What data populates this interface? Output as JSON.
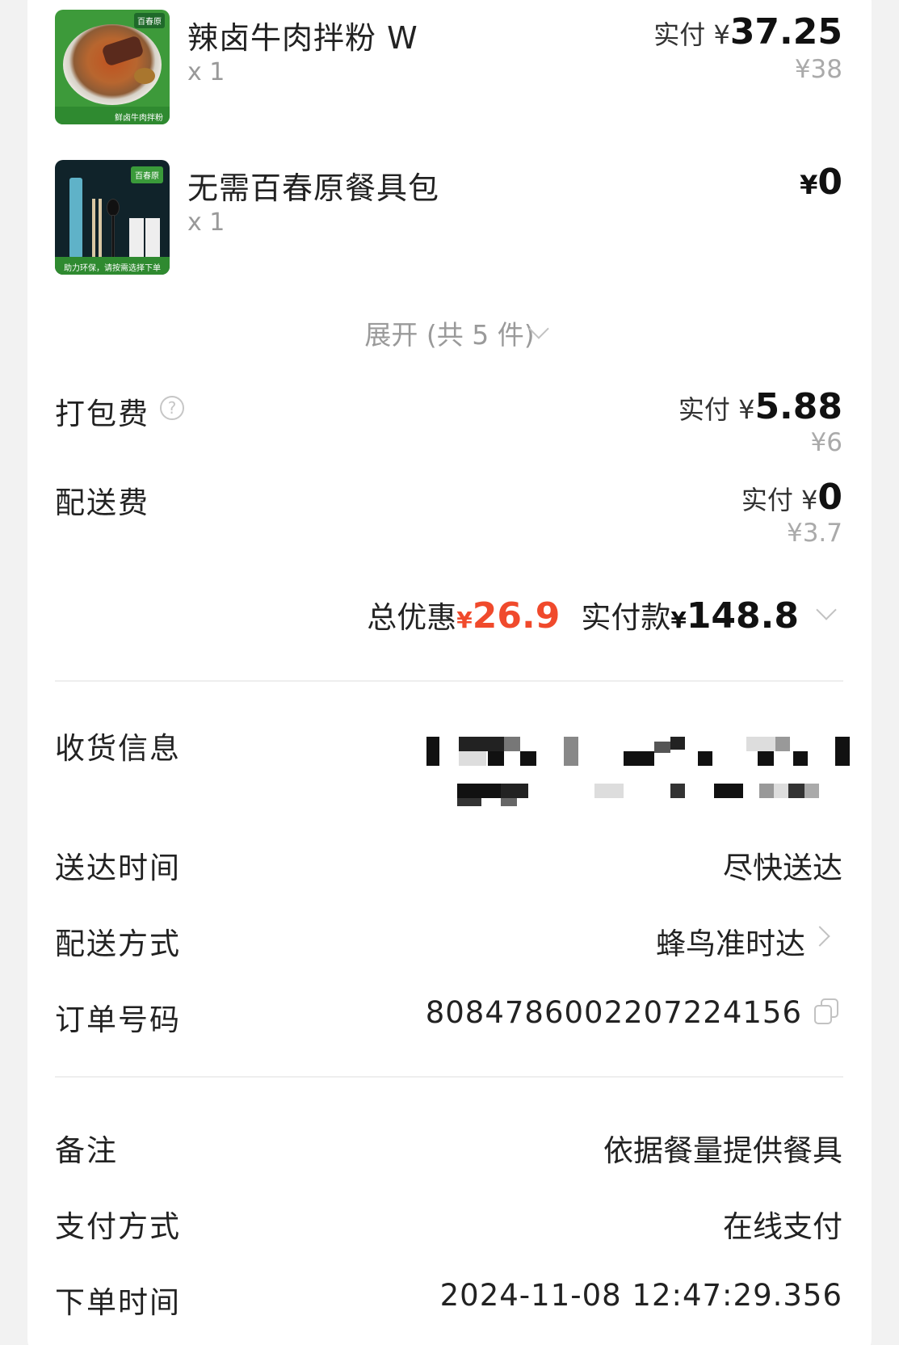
{
  "items": [
    {
      "name": "辣卤牛肉拌粉 W",
      "qty": "x 1",
      "paid_prefix": "实付 ¥",
      "paid_amount": "37.25",
      "original_price": "¥38",
      "thumb_tag": "百春原",
      "thumb_caption": "鲜卤牛肉拌粉"
    },
    {
      "name": "无需百春原餐具包",
      "qty": "x 1",
      "price_symbol": "¥",
      "price_amount": "0",
      "thumb_tag": "百春原",
      "thumb_caption": "助力环保，请按需选择下单"
    }
  ],
  "expand": {
    "label": "展开 (共 5 件)"
  },
  "fees": {
    "packing": {
      "label": "打包费",
      "help_glyph": "?",
      "paid_prefix": "实付 ¥",
      "paid_amount": "5.88",
      "original_price": "¥6"
    },
    "delivery": {
      "label": "配送费",
      "paid_prefix": "实付 ¥",
      "paid_amount": "0",
      "original_price": "¥3.7"
    }
  },
  "summary": {
    "discount_label": "总优惠",
    "discount_symbol": "¥",
    "discount_amount": "26.9",
    "paid_label": "实付款",
    "paid_symbol": "¥",
    "paid_amount": "148.8"
  },
  "details": {
    "receiver": {
      "label": "收货信息"
    },
    "delivery_time": {
      "label": "送达时间",
      "value": "尽快送达"
    },
    "delivery_method": {
      "label": "配送方式",
      "value": "蜂鸟准时达"
    },
    "order_no": {
      "label": "订单号码",
      "value": "8084786002207224156"
    }
  },
  "extra": {
    "remark": {
      "label": "备注",
      "value": "依据餐量提供餐具"
    },
    "payment": {
      "label": "支付方式",
      "value": "在线支付"
    },
    "order_time": {
      "label": "下单时间",
      "value": "2024-11-08 12:47:29.356"
    }
  },
  "colors": {
    "discount_red": "#f04a2c",
    "background": "#f2f2f2",
    "card": "#ffffff"
  }
}
